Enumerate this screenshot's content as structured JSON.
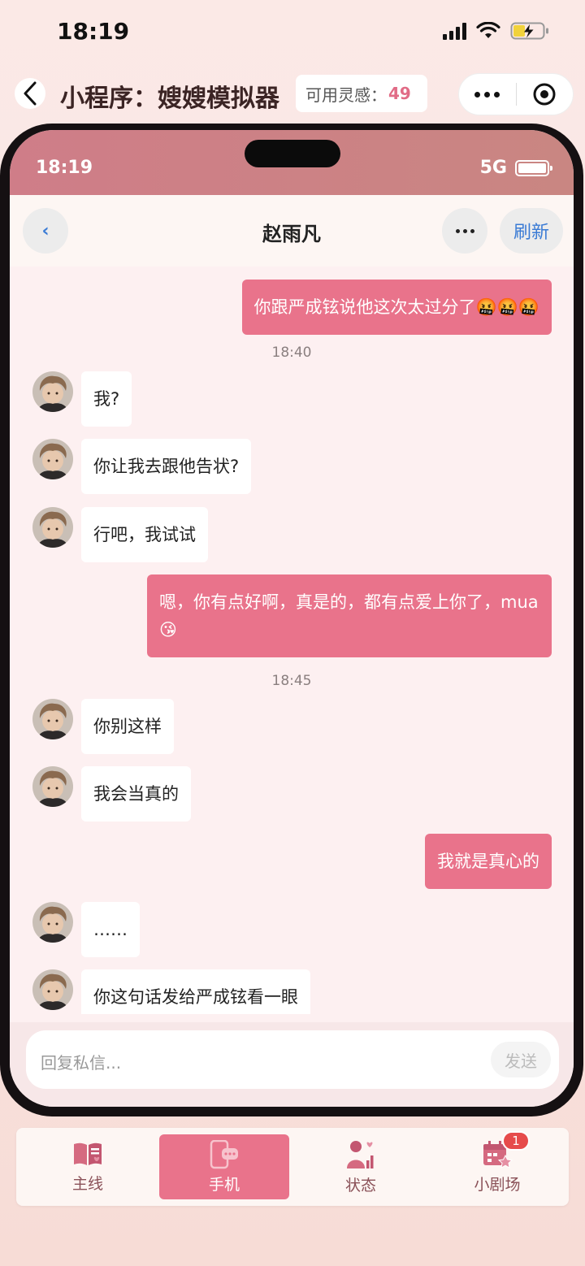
{
  "os_status": {
    "time": "18:19"
  },
  "miniprogram": {
    "title": "小程序：嫂嫂模拟器",
    "inspiration_label": "可用灵感：",
    "inspiration_value": "49"
  },
  "phone": {
    "status": {
      "time": "18:19",
      "network": "5G"
    },
    "chat": {
      "contact_name": "赵雨凡",
      "back_label": "‹",
      "refresh_label": "刷新",
      "messages": [
        {
          "side": "right",
          "text": "你跟严成铉说他这次太过分了🤬🤬🤬"
        },
        {
          "type": "time",
          "text": "18:40"
        },
        {
          "side": "left",
          "text": "我?"
        },
        {
          "side": "left",
          "text": "你让我去跟他告状?"
        },
        {
          "side": "left",
          "text": "行吧，我试试"
        },
        {
          "side": "right",
          "text": "嗯，你有点好啊，真是的，都有点爱上你了，mua😘"
        },
        {
          "type": "time",
          "text": "18:45"
        },
        {
          "side": "left",
          "text": "你别这样"
        },
        {
          "side": "left",
          "text": "我会当真的"
        },
        {
          "side": "right",
          "text": "我就是真心的"
        },
        {
          "side": "left",
          "text": "……"
        },
        {
          "side": "left",
          "text": "你这句话发给严成铉看一眼"
        }
      ],
      "input": {
        "placeholder": "回复私信...",
        "send_label": "发送"
      }
    }
  },
  "tabbar": {
    "tabs": [
      {
        "label": "主线",
        "icon": "book-icon",
        "active": false
      },
      {
        "label": "手机",
        "icon": "phone-chat-icon",
        "active": true
      },
      {
        "label": "状态",
        "icon": "person-stats-icon",
        "active": false
      },
      {
        "label": "小剧场",
        "icon": "calendar-star-icon",
        "active": false,
        "badge": "1"
      }
    ]
  },
  "colors": {
    "accent": "#e9738b",
    "inspiration": "#e16b86",
    "link_blue": "#3a7bd5",
    "badge_red": "#e64b4b"
  }
}
